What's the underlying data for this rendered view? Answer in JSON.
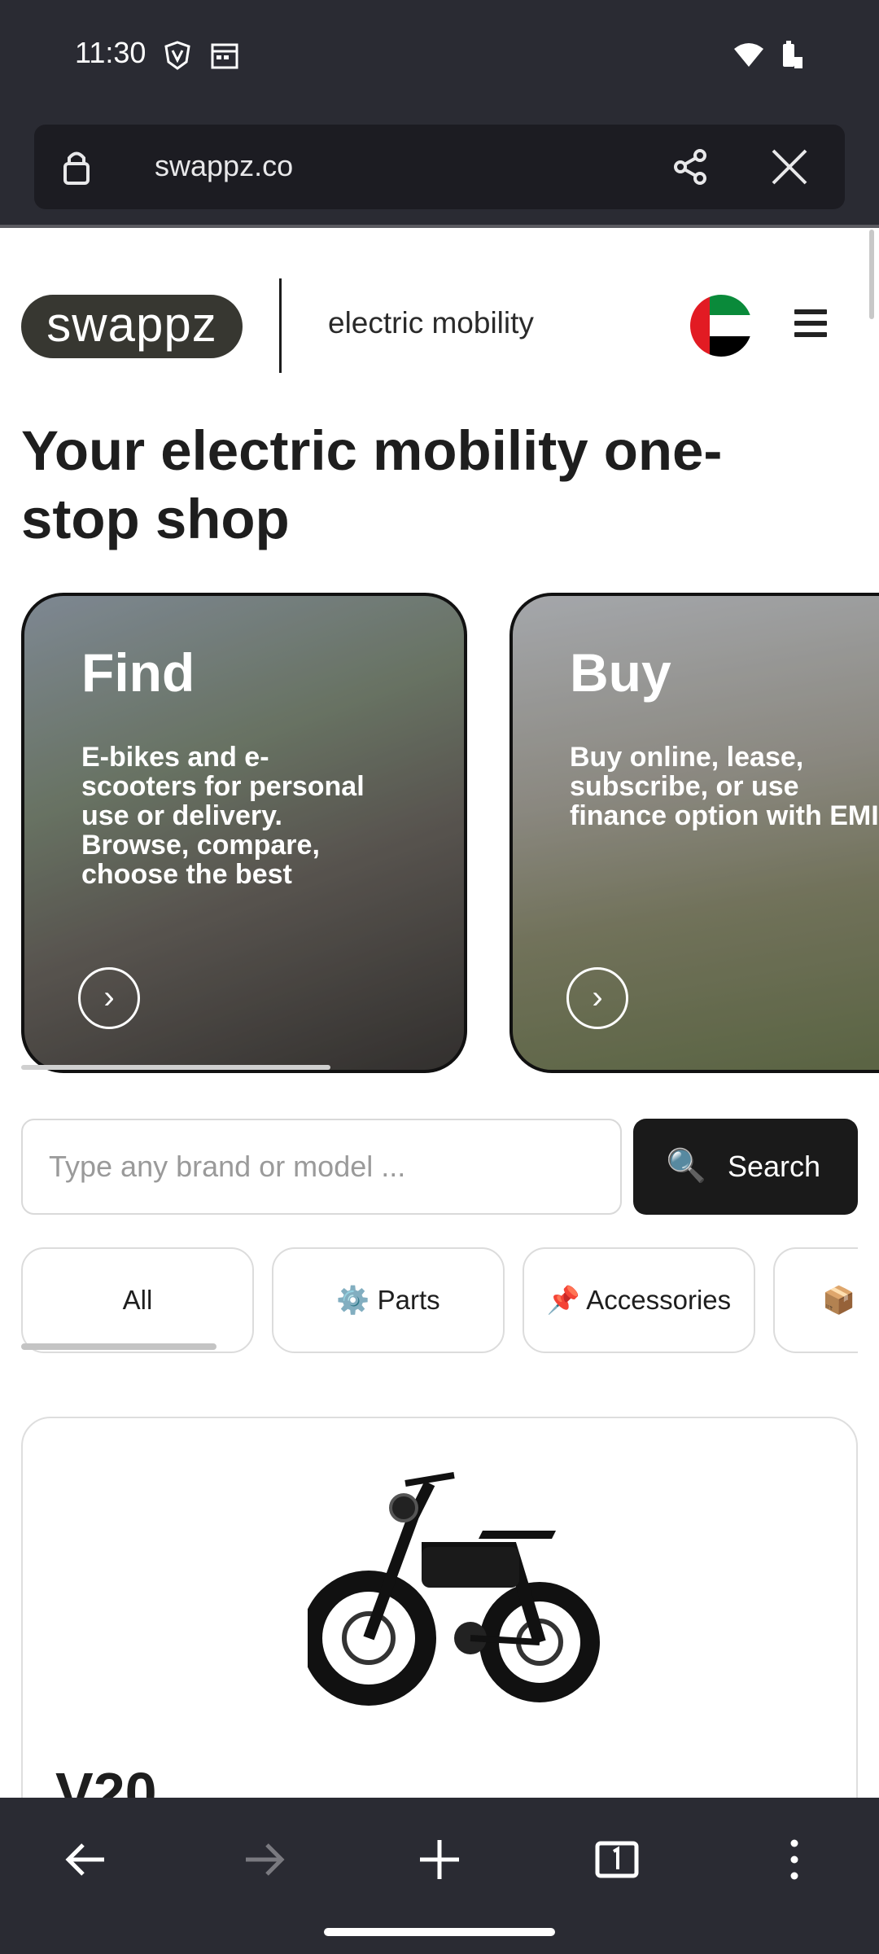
{
  "status_bar": {
    "time": "11:30"
  },
  "browser": {
    "url": "swappz.co"
  },
  "header": {
    "logo": "swappz",
    "tagline": "electric mobility"
  },
  "hero": {
    "headline": "Your electric mobility one-stop shop"
  },
  "cards": [
    {
      "title": "Find",
      "description": "E-bikes and e-scooters for personal use or delivery. Browse, compare, choose the best"
    },
    {
      "title": "Buy",
      "description": "Buy online, lease, subscribe, or use finance option with EMI"
    }
  ],
  "search": {
    "placeholder": "Type any brand or model ...",
    "button_label": "Search",
    "button_icon": "🔍"
  },
  "categories": [
    {
      "label": "All"
    },
    {
      "label": "⚙️ Parts"
    },
    {
      "label": "📌 Accessories"
    },
    {
      "label": "📦"
    }
  ],
  "product": {
    "name": "V20"
  }
}
